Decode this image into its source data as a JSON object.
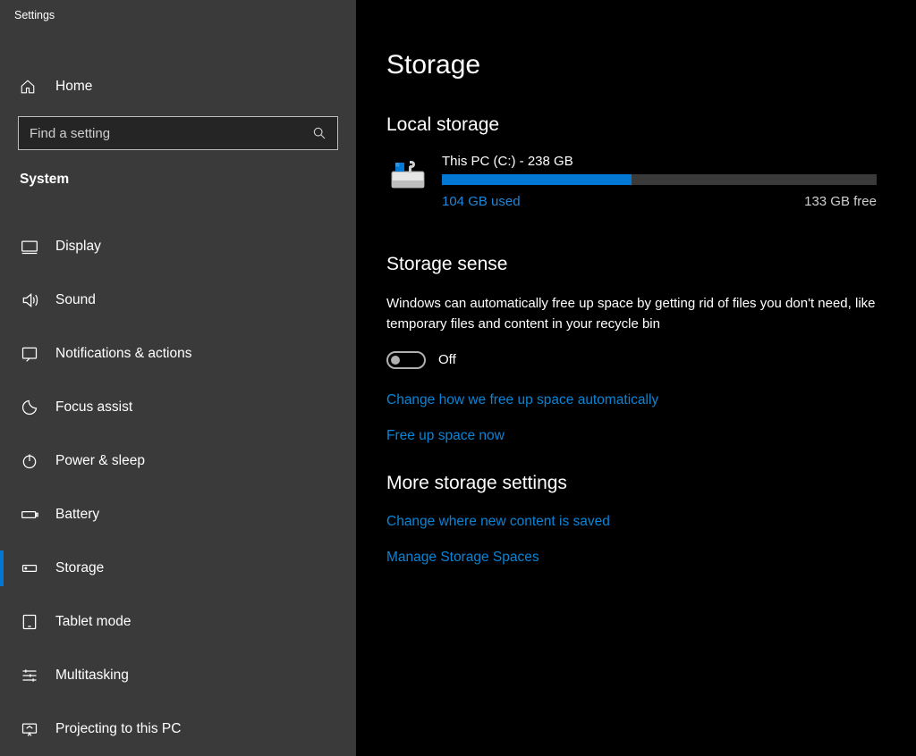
{
  "window_title": "Settings",
  "sidebar": {
    "home_label": "Home",
    "search_placeholder": "Find a setting",
    "group_label": "System",
    "items": [
      {
        "label": "Display",
        "icon": "display-icon"
      },
      {
        "label": "Sound",
        "icon": "sound-icon"
      },
      {
        "label": "Notifications & actions",
        "icon": "notifications-icon"
      },
      {
        "label": "Focus assist",
        "icon": "focus-assist-icon"
      },
      {
        "label": "Power & sleep",
        "icon": "power-icon"
      },
      {
        "label": "Battery",
        "icon": "battery-icon"
      },
      {
        "label": "Storage",
        "icon": "storage-icon",
        "selected": true
      },
      {
        "label": "Tablet mode",
        "icon": "tablet-icon"
      },
      {
        "label": "Multitasking",
        "icon": "multitasking-icon"
      },
      {
        "label": "Projecting to this PC",
        "icon": "projecting-icon"
      }
    ]
  },
  "page": {
    "title": "Storage",
    "local_storage": {
      "title": "Local storage",
      "drive_name": "This PC (C:) - 238 GB",
      "used_label": "104 GB used",
      "free_label": "133 GB free",
      "used_gb": 104,
      "total_gb": 238,
      "used_pct": 43.7
    },
    "storage_sense": {
      "title": "Storage sense",
      "description": "Windows can automatically free up space by getting rid of files you don't need, like temporary files and content in your recycle bin",
      "toggle_state": "Off",
      "toggle_on": false,
      "links": {
        "change_auto": "Change how we free up space automatically",
        "free_now": "Free up space now"
      }
    },
    "more": {
      "title": "More storage settings",
      "links": {
        "change_save": "Change where new content is saved",
        "manage_spaces": "Manage Storage Spaces"
      }
    }
  },
  "colors": {
    "accent": "#0078d4",
    "link": "#0a84d6",
    "sidebar_bg": "#3a3a3a",
    "main_bg": "#000000"
  }
}
